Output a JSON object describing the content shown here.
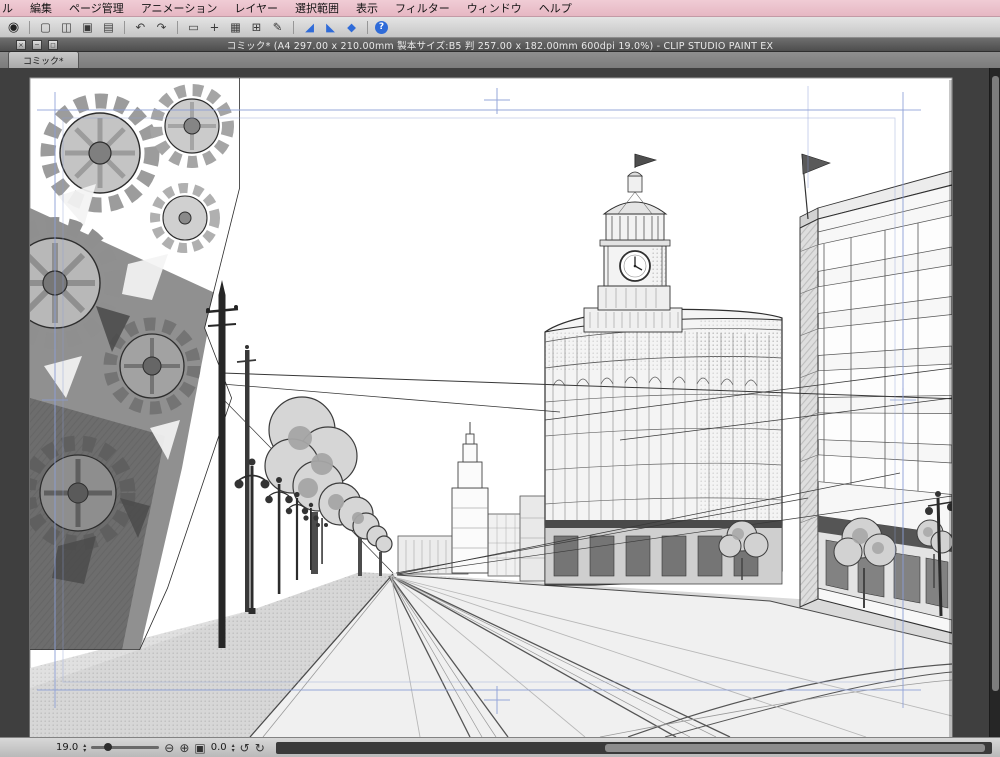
{
  "colors": {
    "menubar-bg": "#f0ccd5",
    "menubar-bg2": "#e6b7c3",
    "accent-blue": "#2f6bd8",
    "guide-blue": "#8b9dd6",
    "canvas-bg": "#3f3f3f"
  },
  "menu_bar": {
    "items": [
      "ル",
      "編集",
      "ページ管理",
      "アニメーション",
      "レイヤー",
      "選択範囲",
      "表示",
      "フィルター",
      "ウィンドウ",
      "ヘルプ"
    ]
  },
  "toolbar": {
    "icons": [
      {
        "name": "app-logo",
        "glyph": "◉"
      },
      {
        "name": "new-document",
        "glyph": "▢"
      },
      {
        "name": "open-document",
        "glyph": "◫"
      },
      {
        "name": "save-document",
        "glyph": "▣"
      },
      {
        "name": "export-document",
        "glyph": "▤"
      },
      {
        "name": "undo",
        "glyph": "↶"
      },
      {
        "name": "redo",
        "glyph": "↷"
      },
      {
        "name": "rect-select",
        "glyph": "▭"
      },
      {
        "name": "move-tool",
        "glyph": "+"
      },
      {
        "name": "grid",
        "glyph": "▦"
      },
      {
        "name": "transform",
        "glyph": "⊞"
      },
      {
        "name": "pen",
        "glyph": "✎"
      },
      {
        "name": "snap-to-ruler",
        "glyph": "◢"
      },
      {
        "name": "snap-to-special-ruler",
        "glyph": "◣"
      },
      {
        "name": "snap-to-grid",
        "glyph": "◆"
      },
      {
        "name": "help",
        "glyph": "?"
      }
    ]
  },
  "window": {
    "title": "コミック* (A4 297.00 x 210.00mm 製本サイズ:B5 判 257.00 x 182.00mm 600dpi 19.0%)  - CLIP STUDIO PAINT EX",
    "controls": {
      "close": "×",
      "minimize": "─",
      "maximize": "◻"
    }
  },
  "tab": {
    "label": "コミック*"
  },
  "status_bar": {
    "zoom_value": "19.0",
    "rotation_value": "0.0",
    "spin_up": "▴",
    "spin_down": "▾",
    "zoom_out": "⊖",
    "zoom_in": "⊕",
    "fit": "▣",
    "rotate_left": "↺",
    "rotate_right": "↻"
  }
}
